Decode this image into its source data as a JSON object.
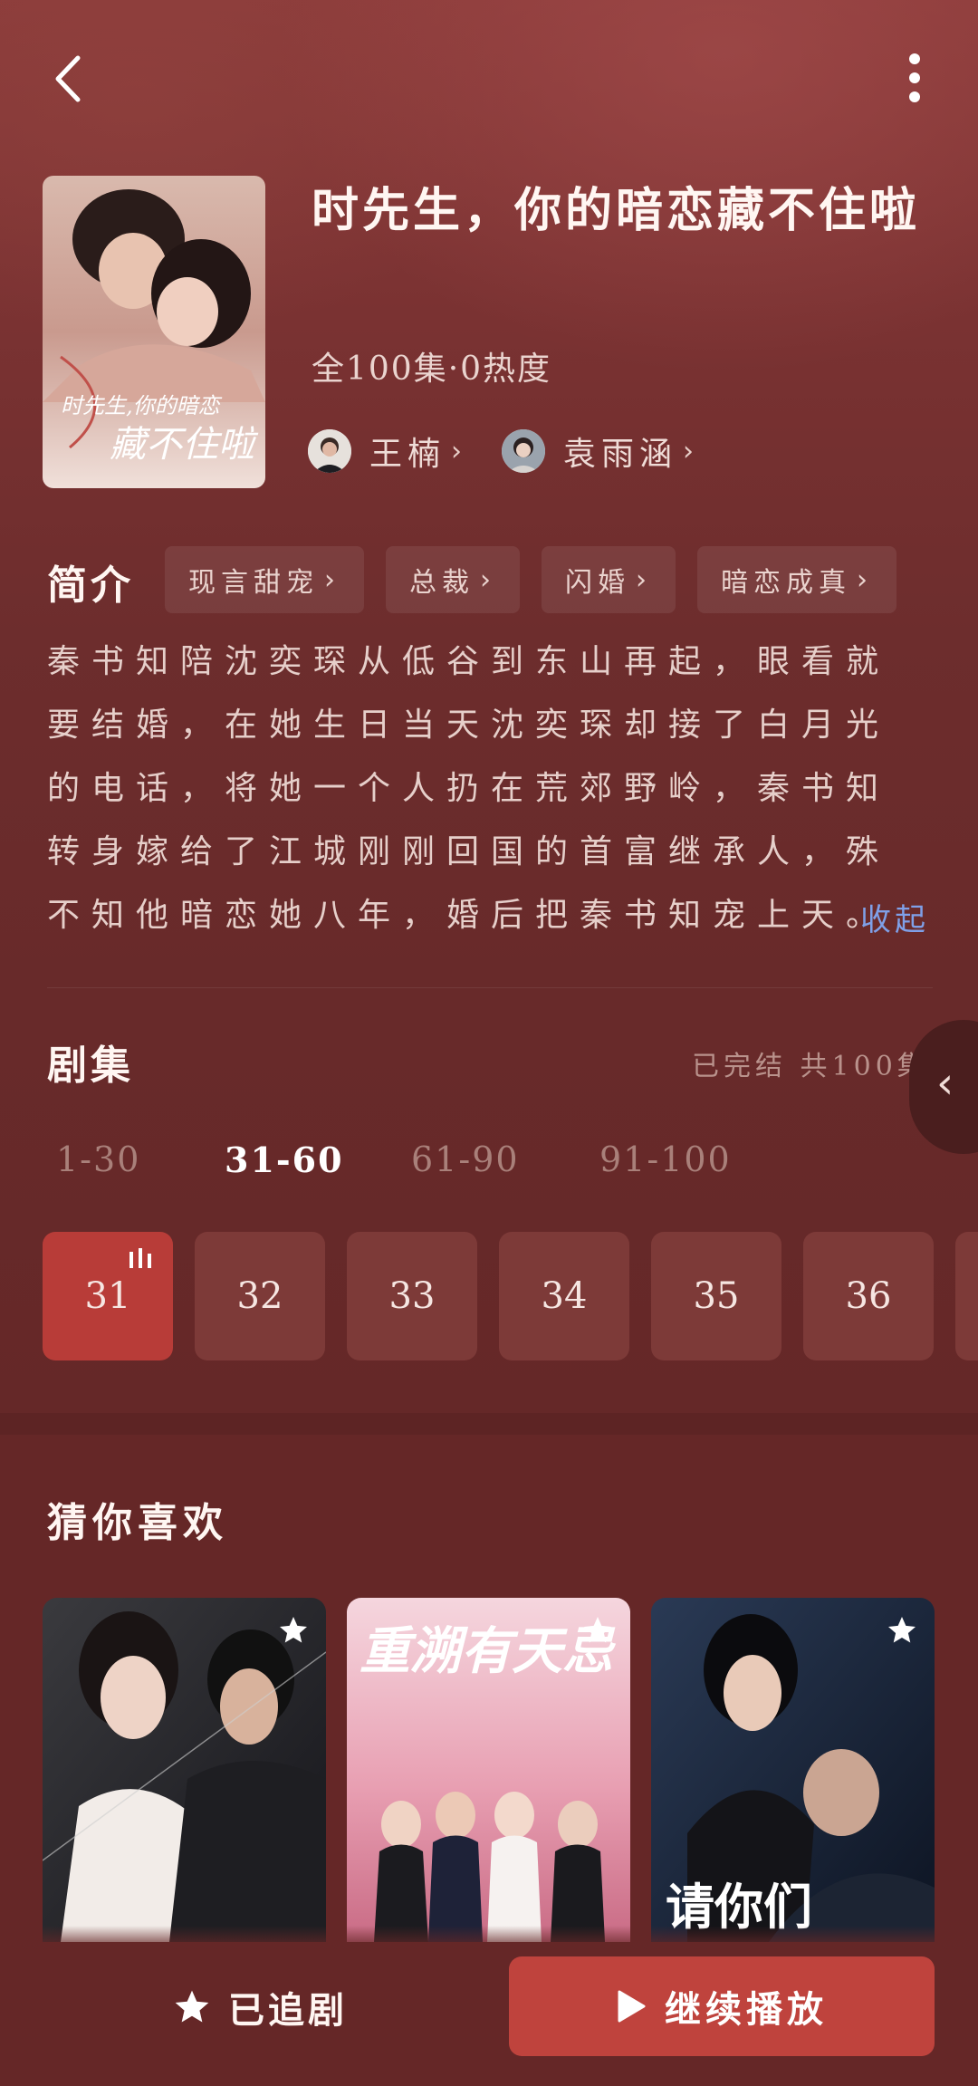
{
  "header": {
    "back_icon": "chevron-left-icon",
    "more_icon": "more-vertical-icon"
  },
  "drama": {
    "title": "时先生，你的暗恋藏不住啦",
    "meta": "全100集·0热度",
    "poster_text_line1": "时先生,你的暗恋",
    "poster_text_line2": "藏不住啦",
    "cast": [
      {
        "name": "王楠",
        "icon": "avatar"
      },
      {
        "name": "袁雨涵",
        "icon": "avatar"
      }
    ]
  },
  "intro": {
    "label": "简介",
    "tags": [
      "现言甜宠",
      "总裁",
      "闪婚",
      "暗恋成真"
    ],
    "synopsis": "秦书知陪沈奕琛从低谷到东山再起，眼看就要结婚，在她生日当天沈奕琛却接了白月光的电话，将她一个人扔在荒郊野岭，秦书知转身嫁给了江城刚刚回国的首富继承人，殊不知他暗恋她八年，婚后把秦书知宠上天。",
    "collapse_label": "收起"
  },
  "episodes": {
    "label": "剧集",
    "status": "已完结 共100集",
    "ranges": [
      "1-30",
      "31-60",
      "61-90",
      "91-100"
    ],
    "active_range": "31-60",
    "items": [
      "31",
      "32",
      "33",
      "34",
      "35",
      "36"
    ],
    "playing": "31"
  },
  "recommend": {
    "label": "猜你喜欢",
    "cards": [
      {
        "title_art": "",
        "icon": "star-icon"
      },
      {
        "title_art": "重溯有天忌",
        "icon": "star-icon"
      },
      {
        "title_art": "请你们",
        "icon": "star-icon"
      }
    ]
  },
  "bottom": {
    "follow_label": "已追剧",
    "follow_icon": "star-icon",
    "play_label": "继续播放",
    "play_icon": "play-icon"
  },
  "colors": {
    "background": "#652727",
    "accent": "#bf433d",
    "link": "#7fa0e8"
  }
}
